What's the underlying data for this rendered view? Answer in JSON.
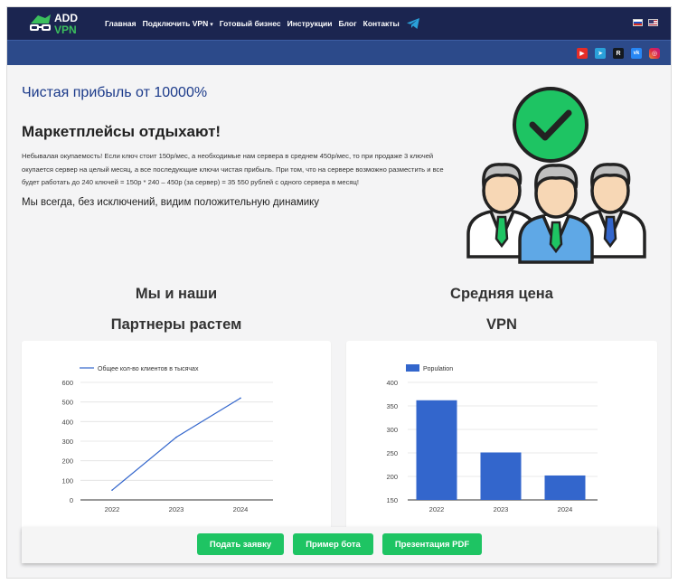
{
  "header": {
    "logo_top": "ADD",
    "logo_bottom": "VPN",
    "nav": [
      {
        "label": "Главная"
      },
      {
        "label": "Подключить VPN",
        "dropdown": true
      },
      {
        "label": "Готовый бизнес"
      },
      {
        "label": "Инструкции"
      },
      {
        "label": "Блог"
      },
      {
        "label": "Контакты"
      }
    ],
    "nav_icon": "telegram-icon",
    "flags": [
      "ru-flag-icon",
      "us-flag-icon"
    ],
    "colors": {
      "topbar": "#1b2550",
      "subbar": "#2c4a8a"
    }
  },
  "socials": [
    {
      "name": "youtube-icon",
      "color": "#e52d27"
    },
    {
      "name": "telegram-icon",
      "color": "#2aa1da"
    },
    {
      "name": "rutube-icon",
      "color": "#14191f"
    },
    {
      "name": "vk-icon",
      "color": "#2787f5"
    },
    {
      "name": "instagram-icon",
      "color": "#d6249f"
    }
  ],
  "hero": {
    "title": "Чистая прибыль от 10000%",
    "heading": "Маркетплейсы отдыхают!",
    "paragraph": "Небывалая окупаемость! Если ключ стоит 150р/мес, а необходимые нам сервера в среднем 450р/мес, то при продаже 3 ключей окупается сервер на целый месяц, а все последующие ключи чистая прибыль. При том, что на сервере возможно разместить и все будет работать до 240 ключей = 150р * 240 – 450р (за сервер) = 35 550 рублей с одного сервера в месяц!",
    "subtext": "Мы всегда, без исключений, видим положительную динамику"
  },
  "sections": {
    "left_title_1": "Мы и наши",
    "left_title_2": "Партнеры растем",
    "right_title_1": "Средняя цена",
    "right_title_2": "VPN"
  },
  "chart_data": [
    {
      "type": "line",
      "x": [
        "2022",
        "2023",
        "2024"
      ],
      "series": [
        {
          "name": "Общее кол-во клиентов в тысячах",
          "values": [
            50,
            320,
            520
          ],
          "color": "#3366cc"
        }
      ],
      "ylim": [
        0,
        600
      ],
      "yticks": [
        0,
        100,
        200,
        300,
        400,
        500,
        600
      ],
      "legend": "top-left",
      "grid": true
    },
    {
      "type": "bar",
      "categories": [
        "2022",
        "2023",
        "2024"
      ],
      "series": [
        {
          "name": "Population",
          "values": [
            362,
            251,
            202
          ],
          "color": "#3366cc"
        }
      ],
      "ylim": [
        150,
        400
      ],
      "yticks": [
        150,
        200,
        250,
        300,
        350,
        400
      ],
      "legend": "top-left",
      "grid": true
    }
  ],
  "actions": {
    "apply": "Подать заявку",
    "bot_example": "Пример бота",
    "presentation": "Презентация PDF",
    "button_color": "#1ec463"
  }
}
